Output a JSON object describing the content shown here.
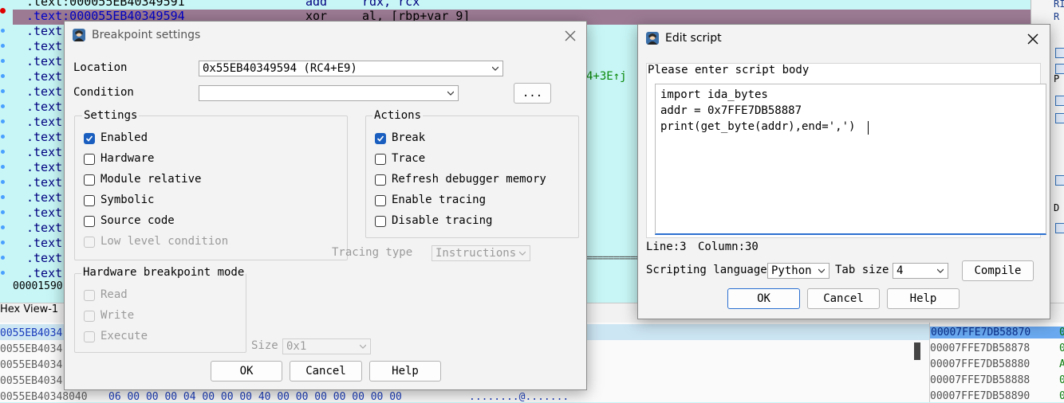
{
  "background": {
    "first_line": ".text:000055EB40349591",
    "first_line_op": "add",
    "first_line_args": "rdx, rcx",
    "highlight_line": ".text:000055EB40349594",
    "highlight_op": "xor",
    "highlight_args": "al, [rbp+var_9]",
    "text_prefix": ".text",
    "xref_fragment": "4+3E↑j",
    "status_fragment": "00001590",
    "hex_view_tab": "Hex View-1",
    "hex_rows": [
      {
        "addr": "0055EB4034",
        "bytes": "",
        "ascii": ""
      },
      {
        "addr": "0055EB4034",
        "bytes": "",
        "ascii": ""
      },
      {
        "addr": "0055EB4034",
        "bytes": "",
        "ascii": ""
      },
      {
        "addr": "0055EB4034",
        "bytes": "",
        "ascii": ""
      },
      {
        "addr": "0055EB40348040",
        "bytes": "06 00 00 00 04 00 00 00  40 00 00 00 00 00 00 00",
        "ascii": "........@......."
      }
    ],
    "stack_rows": [
      {
        "addr": "00007FFE7DB58870",
        "val": "0"
      },
      {
        "addr": "00007FFE7DB58878",
        "val": "0"
      },
      {
        "addr": "00007FFE7DB58880",
        "val": "A"
      },
      {
        "addr": "00007FFE7DB58888",
        "val": "0"
      },
      {
        "addr": "00007FFE7DB58890",
        "val": "0"
      }
    ],
    "right_panel": [
      "RI",
      "R",
      "P",
      "D"
    ]
  },
  "breakpoint_dialog": {
    "title": "Breakpoint settings",
    "location_label": "Location",
    "location_value": "0x55EB40349594 (RC4+E9)",
    "condition_label": "Condition",
    "condition_value": "",
    "ellipsis_label": "...",
    "settings_title": "Settings",
    "settings": [
      {
        "label": "Enabled",
        "checked": true,
        "disabled": false
      },
      {
        "label": "Hardware",
        "checked": false,
        "disabled": false
      },
      {
        "label": "Module relative",
        "checked": false,
        "disabled": false
      },
      {
        "label": "Symbolic",
        "checked": false,
        "disabled": false
      },
      {
        "label": "Source code",
        "checked": false,
        "disabled": false
      },
      {
        "label": "Low level condition",
        "checked": false,
        "disabled": true
      }
    ],
    "actions_title": "Actions",
    "actions": [
      {
        "label": "Break",
        "checked": true
      },
      {
        "label": "Trace",
        "checked": false
      },
      {
        "label": "Refresh debugger memory",
        "checked": false
      },
      {
        "label": "Enable tracing",
        "checked": false
      },
      {
        "label": "Disable tracing",
        "checked": false
      }
    ],
    "tracing_type_label": "Tracing type",
    "tracing_type_value": "Instructions",
    "hw_mode_title": "Hardware breakpoint mode",
    "hw_modes": [
      {
        "label": "Read"
      },
      {
        "label": "Write"
      },
      {
        "label": "Execute"
      }
    ],
    "size_label": "Size",
    "size_value": "0x1",
    "ok_label": "OK",
    "cancel_label": "Cancel",
    "help_label": "Help"
  },
  "script_dialog": {
    "title": "Edit script",
    "prompt": "Please enter script body",
    "code_lines": [
      "import ida_bytes",
      "addr = 0x7FFE7DB58887",
      "print(get_byte(addr),end=',')"
    ],
    "line_status": "Line:3",
    "column_status": "Column:30",
    "lang_label": "Scripting language",
    "lang_value": "Python",
    "tab_label": "Tab size",
    "tab_value": "4",
    "compile_label": "Compile",
    "ok_label": "OK",
    "cancel_label": "Cancel",
    "help_label": "Help"
  },
  "colors": {
    "disasm_bg": "#c8f6f6",
    "highlight_row": "#9c7a94",
    "accent_blue": "#2a6fd0",
    "checkbox_on": "#1a5fc0"
  }
}
